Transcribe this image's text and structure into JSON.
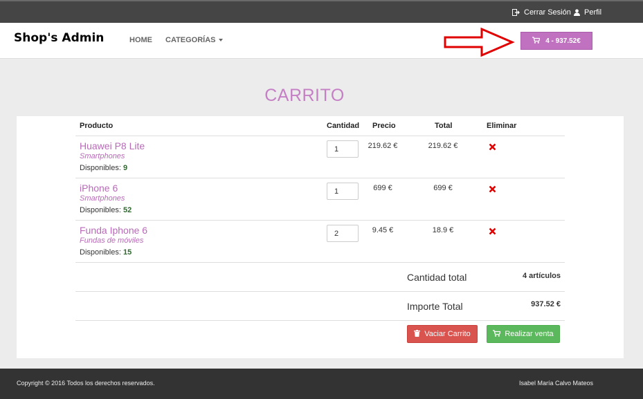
{
  "topbar": {
    "logout_label": "Cerrar Sesión",
    "profile_label": "Perfil"
  },
  "navbar": {
    "brand": "Shop's Admin",
    "home_label": "HOME",
    "categories_label": "CATEGORÍAS",
    "cart_label": "4 - 937.52€"
  },
  "page": {
    "title": "CARRITO"
  },
  "table": {
    "headers": {
      "product": "Producto",
      "quantity": "Cantidad",
      "price": "Precio",
      "total": "Total",
      "remove": "Eliminar"
    },
    "stock_label": "Disponibles:",
    "rows": [
      {
        "name": "Huawei P8 Lite",
        "category": "Smartphones",
        "stock": "9",
        "quantity": "1",
        "price": "219.62 €",
        "total": "219.62 €"
      },
      {
        "name": "iPhone 6",
        "category": "Smartphones",
        "stock": "52",
        "quantity": "1",
        "price": "699 €",
        "total": "699 €"
      },
      {
        "name": "Funda Iphone 6",
        "category": "Fundas de móviles",
        "stock": "15",
        "quantity": "2",
        "price": "9.45 €",
        "total": "18.9 €"
      }
    ]
  },
  "summary": {
    "quantity_label": "Cantidad total",
    "quantity_value": "4 artículos",
    "amount_label": "Importe Total",
    "amount_value": "937.52 €"
  },
  "actions": {
    "empty_label": "Vaciar Carrito",
    "checkout_label": "Realizar venta"
  },
  "footer": {
    "copyright": "Copyright © 2016 Todos los derechos reservados.",
    "author": "Isabel María Calvo Mateos"
  },
  "colors": {
    "accent": "#c072c0",
    "danger": "#d9534f",
    "success": "#5cb85c",
    "arrow": "#e00000"
  },
  "icons": [
    "logout-icon",
    "user-icon",
    "cart-icon",
    "remove-icon",
    "trash-icon",
    "red-arrow-icon"
  ]
}
